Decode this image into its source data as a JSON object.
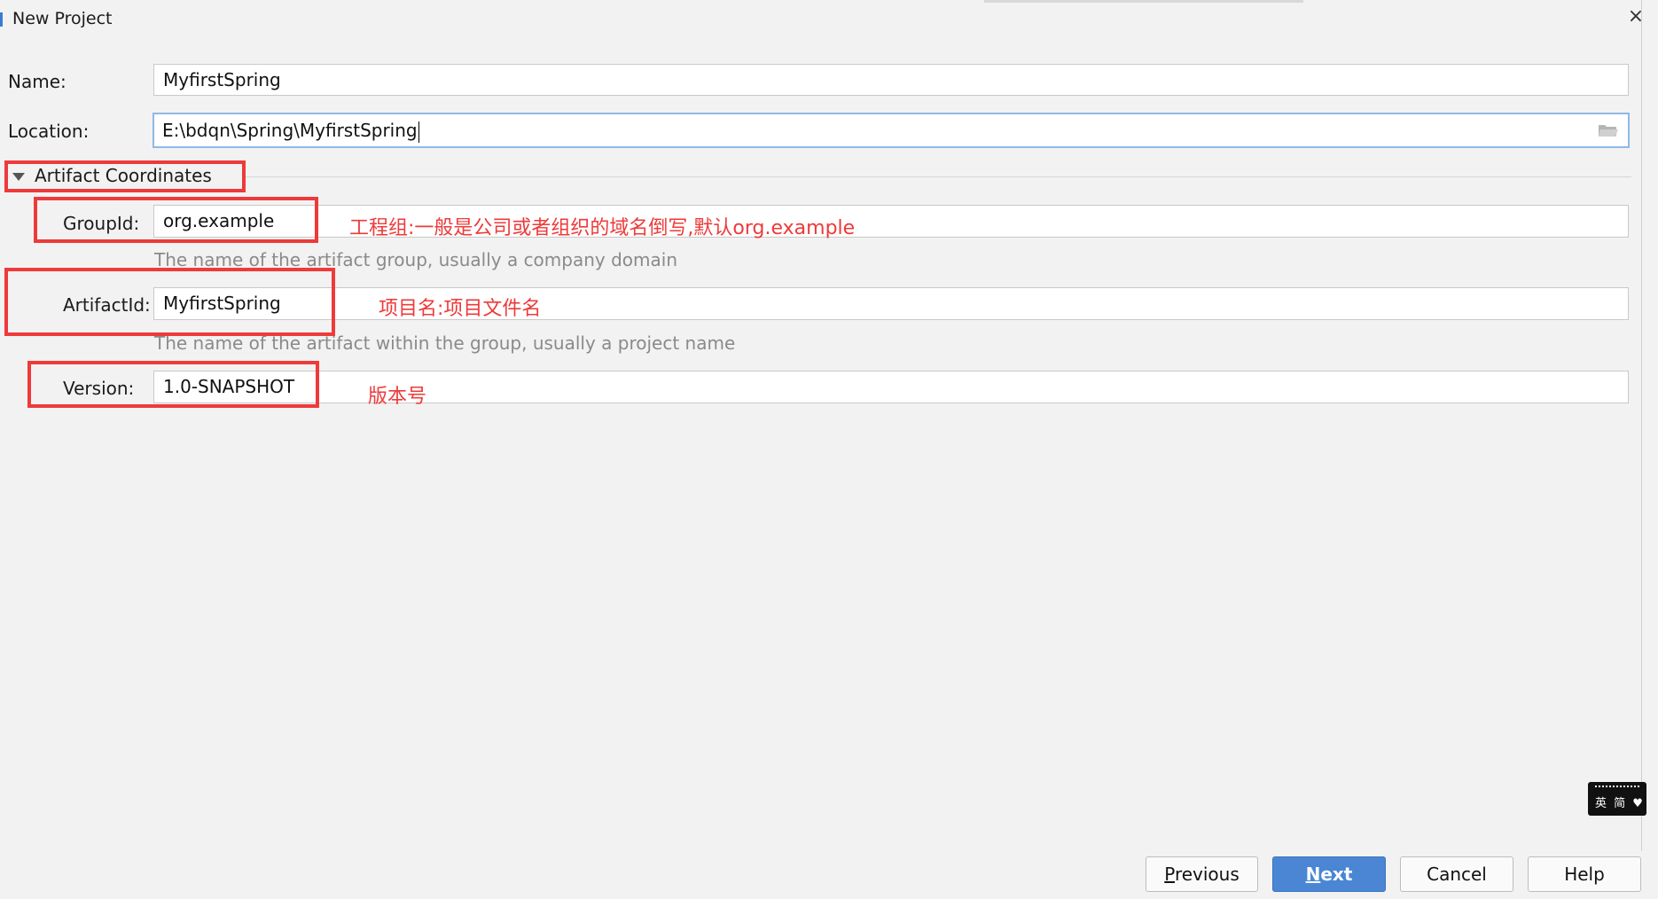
{
  "window": {
    "title": "New Project",
    "close_glyph": "×"
  },
  "form": {
    "name": {
      "label": "Name:",
      "value": "MyfirstSpring"
    },
    "location": {
      "label": "Location:",
      "value": "E:\\bdqn\\Spring\\MyfirstSpring",
      "browse_icon": "folder-icon"
    },
    "section": {
      "title": "Artifact Coordinates",
      "icon": "collapse-triangle-icon"
    },
    "group_id": {
      "label": "GroupId:",
      "value": "org.example",
      "hint": "The name of the artifact group, usually a company domain"
    },
    "artifact_id": {
      "label": "ArtifactId:",
      "value": "MyfirstSpring",
      "hint": "The name of the artifact within the group, usually a project name"
    },
    "version": {
      "label": "Version:",
      "value": "1.0-SNAPSHOT"
    }
  },
  "annotations": {
    "group_id": "工程组:一般是公司或者组织的域名倒写,默认org.example",
    "artifact_id": "项目名:项目文件名",
    "version": "版本号",
    "color": "#ee3a3a"
  },
  "ime": {
    "text": "英 简 ♥"
  },
  "buttons": {
    "previous": {
      "mnemonic": "P",
      "rest": "revious"
    },
    "next": {
      "mnemonic": "N",
      "rest": "ext"
    },
    "cancel": "Cancel",
    "help": "Help"
  },
  "colors": {
    "accent": "#4a86d4",
    "background": "#f2f2f2",
    "focus_border": "#8fb9e8"
  }
}
